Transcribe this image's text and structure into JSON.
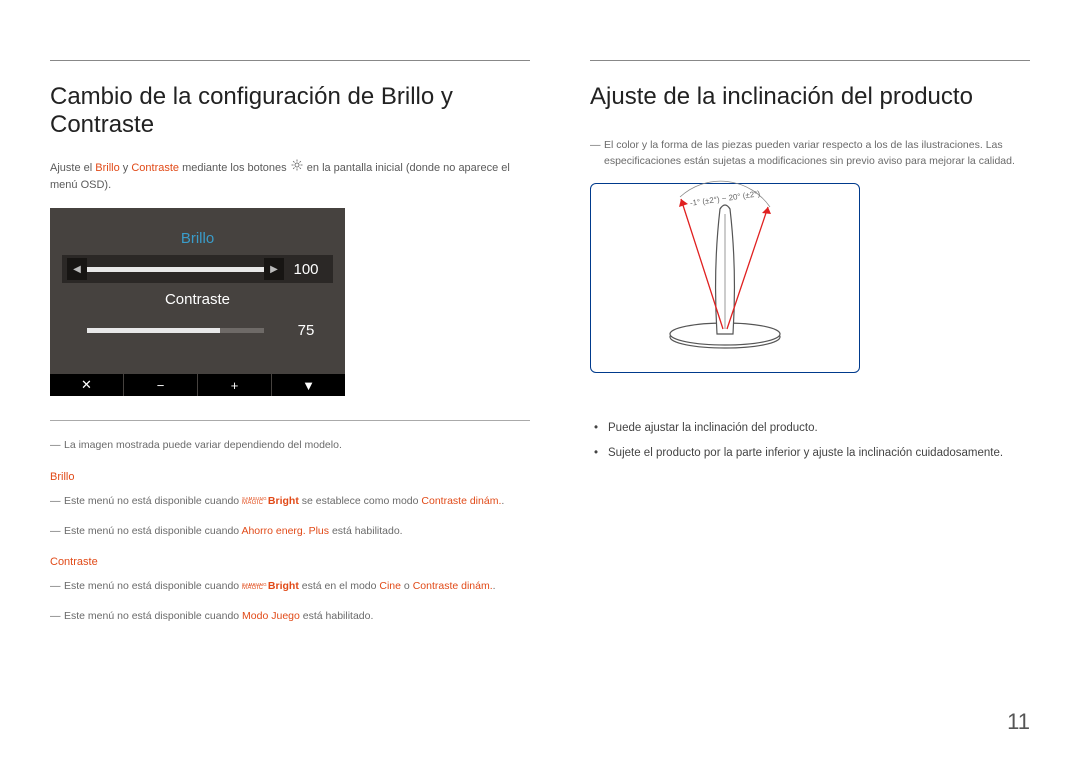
{
  "pageNumber": "11",
  "left": {
    "title": "Cambio de la configuración de Brillo y Contraste",
    "intro_prefix": "Ajuste el ",
    "intro_h1": "Brillo",
    "intro_mid1": " y ",
    "intro_h2": "Contraste",
    "intro_mid2": " mediante los botones ",
    "intro_suffix": " en la pantalla inicial (donde no aparece el menú OSD).",
    "osd": {
      "brillo_label": "Brillo",
      "brillo_value": "100",
      "contraste_label": "Contraste",
      "contraste_value": "75",
      "brillo_fill_pct": 100,
      "contraste_fill_pct": 75
    },
    "after_rule_note": "La imagen mostrada puede variar dependiendo del modelo.",
    "brillo_head": "Brillo",
    "brillo_note1_a": "Este menú no está disponible cuando ",
    "brillo_note1_b": "Bright",
    "brillo_note1_c": " se establece como modo ",
    "brillo_note1_d": "Contraste dinám.",
    "brillo_note1_e": ".",
    "brillo_note2_a": "Este menú no está disponible cuando ",
    "brillo_note2_b": "Ahorro energ. Plus",
    "brillo_note2_c": " está habilitado.",
    "contraste_head": "Contraste",
    "contraste_note1_a": "Este menú no está disponible cuando ",
    "contraste_note1_b": "Bright",
    "contraste_note1_c": " está en el modo ",
    "contraste_note1_d": "Cine",
    "contraste_note1_e": " o ",
    "contraste_note1_f": "Contraste dinám.",
    "contraste_note1_g": ".",
    "contraste_note2_a": "Este menú no está disponible cuando ",
    "contraste_note2_b": "Modo Juego",
    "contraste_note2_c": " está habilitado.",
    "samsung_top": "SAMSUNG",
    "samsung_bot": "MAGIC"
  },
  "right": {
    "title": "Ajuste de la inclinación del producto",
    "note_a": "El color y la forma de las piezas pueden variar respecto a los de las ilustraciones. Las especificaciones están sujetas a modificaciones sin previo aviso para mejorar la calidad.",
    "arc_label": "-1° (±2°) ~ 20° (±2°)",
    "bullet1": "Puede ajustar la inclinación del producto.",
    "bullet2": "Sujete el producto por la parte inferior y ajuste la inclinación cuidadosamente."
  }
}
